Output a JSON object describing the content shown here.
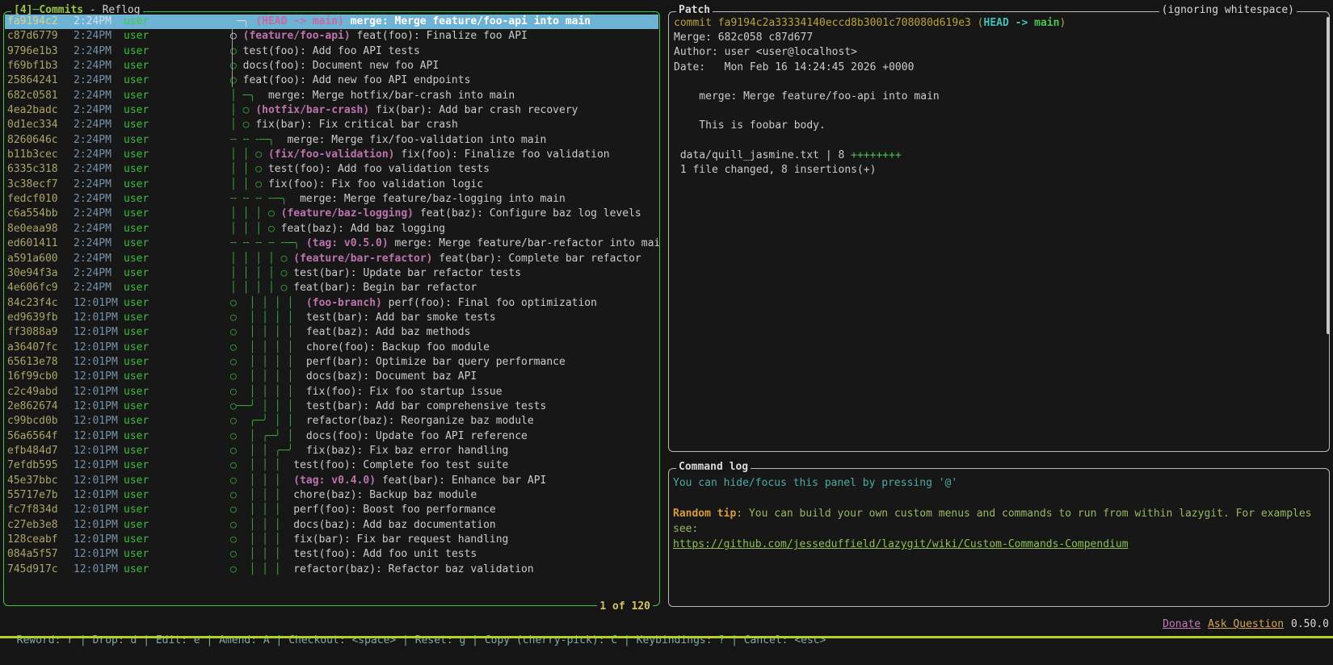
{
  "colors": {
    "selection_bg": "#6fb3d4",
    "focus_border": "#49c249",
    "panel_border": "#b9b9b9",
    "graph_green": "#3aa33a",
    "ref_magenta": "#bd73ad",
    "hash_yellow": "#aaa568",
    "time_blue": "#7492ab",
    "author_green": "#3dbd3d",
    "bottom_bar": "#b4d026"
  },
  "commits_panel": {
    "key": "[4]",
    "title": "Commits",
    "subtitle": " - Reflog",
    "count": "1 of 120",
    "rows": [
      {
        "h": "fa9194c2",
        "t": "2:24PM",
        "a": "user",
        "g": " ─╮ ",
        "gc": "g-w",
        "r": "(HEAD -> main)",
        "m": " merge: Merge feature/foo-api into main",
        "sel": true
      },
      {
        "h": "c87d6779",
        "t": "2:24PM",
        "a": "user",
        "g": "○ ",
        "gc": "g-w",
        "r": "(feature/foo-api)",
        "m": " feat(foo): Finalize foo API"
      },
      {
        "h": "9796e1b3",
        "t": "2:24PM",
        "a": "user",
        "g": "○ ",
        "r": "",
        "m": "test(foo): Add foo API tests"
      },
      {
        "h": "f69bf1b3",
        "t": "2:24PM",
        "a": "user",
        "g": "○ ",
        "r": "",
        "m": "docs(foo): Document new foo API"
      },
      {
        "h": "25864241",
        "t": "2:24PM",
        "a": "user",
        "g": "○ ",
        "r": "",
        "m": "feat(foo): Add new foo API endpoints"
      },
      {
        "h": "682c0581",
        "t": "2:24PM",
        "a": "user",
        "g": "│ ─╮ ",
        "r": "",
        "m": " merge: Merge hotfix/bar-crash into main"
      },
      {
        "h": "4ea2badc",
        "t": "2:24PM",
        "a": "user",
        "g": "│ ○ ",
        "r": "(hotfix/bar-crash)",
        "m": " fix(bar): Add bar crash recovery"
      },
      {
        "h": "0d1ec334",
        "t": "2:24PM",
        "a": "user",
        "g": "│ ○ ",
        "r": "",
        "m": "fix(bar): Fix critical bar crash"
      },
      {
        "h": "8260646c",
        "t": "2:24PM",
        "a": "user",
        "g": "╌ ╌ ╌─╮ ",
        "r": "",
        "m": " merge: Merge fix/foo-validation into main"
      },
      {
        "h": "b11b3cec",
        "t": "2:24PM",
        "a": "user",
        "g": "│ │ ○ ",
        "r": "(fix/foo-validation)",
        "m": " fix(foo): Finalize foo validation"
      },
      {
        "h": "6335c318",
        "t": "2:24PM",
        "a": "user",
        "g": "│ │ ○ ",
        "r": "",
        "m": "test(foo): Add foo validation tests"
      },
      {
        "h": "3c38ecf7",
        "t": "2:24PM",
        "a": "user",
        "g": "│ │ ○ ",
        "r": "",
        "m": "fix(foo): Fix foo validation logic"
      },
      {
        "h": "fedcf010",
        "t": "2:24PM",
        "a": "user",
        "g": "╌ ╌ ╌ ╌─╮ ",
        "r": "",
        "m": " merge: Merge feature/baz-logging into main"
      },
      {
        "h": "c6a554bb",
        "t": "2:24PM",
        "a": "user",
        "g": "│ │ │ ○ ",
        "r": "(feature/baz-logging)",
        "m": " feat(baz): Configure baz log levels"
      },
      {
        "h": "8e0eaa98",
        "t": "2:24PM",
        "a": "user",
        "g": "│ │ │ ○ ",
        "r": "",
        "m": "feat(baz): Add baz logging"
      },
      {
        "h": "ed601411",
        "t": "2:24PM",
        "a": "user",
        "g": "╌ ╌ ╌ ╌ ╌─╮ ",
        "r": "(tag: v0.5.0)",
        "m": " merge: Merge feature/bar-refactor into mai"
      },
      {
        "h": "a591a600",
        "t": "2:24PM",
        "a": "user",
        "g": "│ │ │ │ ○ ",
        "r": "(feature/bar-refactor)",
        "m": " feat(bar): Complete bar refactor"
      },
      {
        "h": "30e94f3a",
        "t": "2:24PM",
        "a": "user",
        "g": "│ │ │ │ ○ ",
        "r": "",
        "m": "test(bar): Update bar refactor tests"
      },
      {
        "h": "4e606fc9",
        "t": "2:24PM",
        "a": "user",
        "g": "│ │ │ │ ○ ",
        "r": "",
        "m": "feat(bar): Begin bar refactor"
      },
      {
        "h": "84c23f4c",
        "t": "12:01PM",
        "a": "user",
        "g": "○  │ │ │ │  ",
        "r": "(foo-branch)",
        "m": " perf(foo): Final foo optimization"
      },
      {
        "h": "ed9639fb",
        "t": "12:01PM",
        "a": "user",
        "g": "○  │ │ │ │  ",
        "r": "",
        "m": "test(bar): Add bar smoke tests"
      },
      {
        "h": "ff3088a9",
        "t": "12:01PM",
        "a": "user",
        "g": "○  │ │ │ │  ",
        "r": "",
        "m": "feat(baz): Add baz methods"
      },
      {
        "h": "a36407fc",
        "t": "12:01PM",
        "a": "user",
        "g": "○  │ │ │ │  ",
        "r": "",
        "m": "chore(foo): Backup foo module"
      },
      {
        "h": "65613e78",
        "t": "12:01PM",
        "a": "user",
        "g": "○  │ │ │ │  ",
        "r": "",
        "m": "perf(bar): Optimize bar query performance"
      },
      {
        "h": "16f99cb0",
        "t": "12:01PM",
        "a": "user",
        "g": "○  │ │ │ │  ",
        "r": "",
        "m": "docs(baz): Document baz API"
      },
      {
        "h": "c2c49abd",
        "t": "12:01PM",
        "a": "user",
        "g": "○  │ │ │ │  ",
        "r": "",
        "m": "fix(foo): Fix foo startup issue"
      },
      {
        "h": "2e862674",
        "t": "12:01PM",
        "a": "user",
        "g": "○──╯ │ │ │  ",
        "r": "",
        "m": "test(bar): Add bar comprehensive tests"
      },
      {
        "h": "c99bcd0b",
        "t": "12:01PM",
        "a": "user",
        "g": "○  ╭─╯ │ │  ",
        "r": "",
        "m": "refactor(baz): Reorganize baz module"
      },
      {
        "h": "56a6564f",
        "t": "12:01PM",
        "a": "user",
        "g": "○  │ ╭─╯ │  ",
        "r": "",
        "m": "docs(foo): Update foo API reference"
      },
      {
        "h": "efb484d7",
        "t": "12:01PM",
        "a": "user",
        "g": "○  │ │ ╭─╯  ",
        "r": "",
        "m": "fix(baz): Fix baz error handling"
      },
      {
        "h": "7efdb595",
        "t": "12:01PM",
        "a": "user",
        "g": "○  │ │ │  ",
        "r": "",
        "m": "test(foo): Complete foo test suite"
      },
      {
        "h": "45e37bbc",
        "t": "12:01PM",
        "a": "user",
        "g": "○  │ │ │  ",
        "r": "(tag: v0.4.0)",
        "m": " feat(bar): Enhance bar API"
      },
      {
        "h": "55717e7b",
        "t": "12:01PM",
        "a": "user",
        "g": "○  │ │ │  ",
        "r": "",
        "m": "chore(baz): Backup baz module"
      },
      {
        "h": "fc7f834d",
        "t": "12:01PM",
        "a": "user",
        "g": "○  │ │ │  ",
        "r": "",
        "m": "perf(foo): Boost foo performance"
      },
      {
        "h": "c27eb3e8",
        "t": "12:01PM",
        "a": "user",
        "g": "○  │ │ │  ",
        "r": "",
        "m": "docs(baz): Add baz documentation"
      },
      {
        "h": "128ceabf",
        "t": "12:01PM",
        "a": "user",
        "g": "○  │ │ │  ",
        "r": "",
        "m": "fix(bar): Fix bar request handling"
      },
      {
        "h": "084a5f57",
        "t": "12:01PM",
        "a": "user",
        "g": "○  │ │ │  ",
        "r": "",
        "m": "test(foo): Add foo unit tests"
      },
      {
        "h": "745d917c",
        "t": "12:01PM",
        "a": "user",
        "g": "○  │ │ │  ",
        "r": "",
        "m": "refactor(baz): Refactor baz validation"
      }
    ]
  },
  "patch_panel": {
    "title": "Patch",
    "right_title": "(ignoring whitespace)",
    "lines": [
      [
        {
          "t": "commit fa9194c2a33334140eccd8b3001c708080d619e3 (",
          "c": "y"
        },
        {
          "t": "HEAD ->",
          "c": "cy"
        },
        {
          "t": " ",
          "c": "y"
        },
        {
          "t": "main",
          "c": "gb"
        },
        {
          "t": ")",
          "c": "y"
        }
      ],
      [
        {
          "t": "Merge: 682c058 c87d677",
          "c": "w"
        }
      ],
      [
        {
          "t": "Author: user <user@localhost>",
          "c": "w"
        }
      ],
      [
        {
          "t": "Date:   Mon Feb 16 14:24:45 2026 +0000",
          "c": "w"
        }
      ],
      [],
      [
        {
          "t": "    merge: Merge feature/foo-api into main",
          "c": "w"
        }
      ],
      [],
      [
        {
          "t": "    This is foobar body.",
          "c": "w"
        }
      ],
      [],
      [
        {
          "t": " data/quill_jasmine.txt | 8 ",
          "c": "w"
        },
        {
          "t": "++++++++",
          "c": "gr"
        }
      ],
      [
        {
          "t": " 1 file changed, 8 insertions(+)",
          "c": "w"
        }
      ]
    ]
  },
  "command_log_panel": {
    "title": "Command log",
    "lines": [
      [
        {
          "t": "You can hide/focus this panel by pressing '@'",
          "c": "tl"
        }
      ],
      [],
      [
        {
          "t": "Random tip",
          "c": "or"
        },
        {
          "t": ": ",
          "c": "tg"
        },
        {
          "t": "You can build your own custom menus and commands to run from within lazygit. For examples",
          "c": "tg"
        }
      ],
      [
        {
          "t": "see:",
          "c": "tg"
        }
      ],
      [
        {
          "t": "https://github.com/jesseduffield/lazygit/wiki/Custom-Commands-Compendium",
          "c": "lk"
        }
      ]
    ]
  },
  "status_bar": {
    "keybindings": "Reword: r | Drop: d | Edit: e | Amend: A | Checkout: <space> | Reset: g | Copy (cherry-pick): C | Keybindings: ? | Cancel: <esc>",
    "donate": "Donate",
    "ask_question": "Ask Question",
    "version": "0.50.0"
  }
}
